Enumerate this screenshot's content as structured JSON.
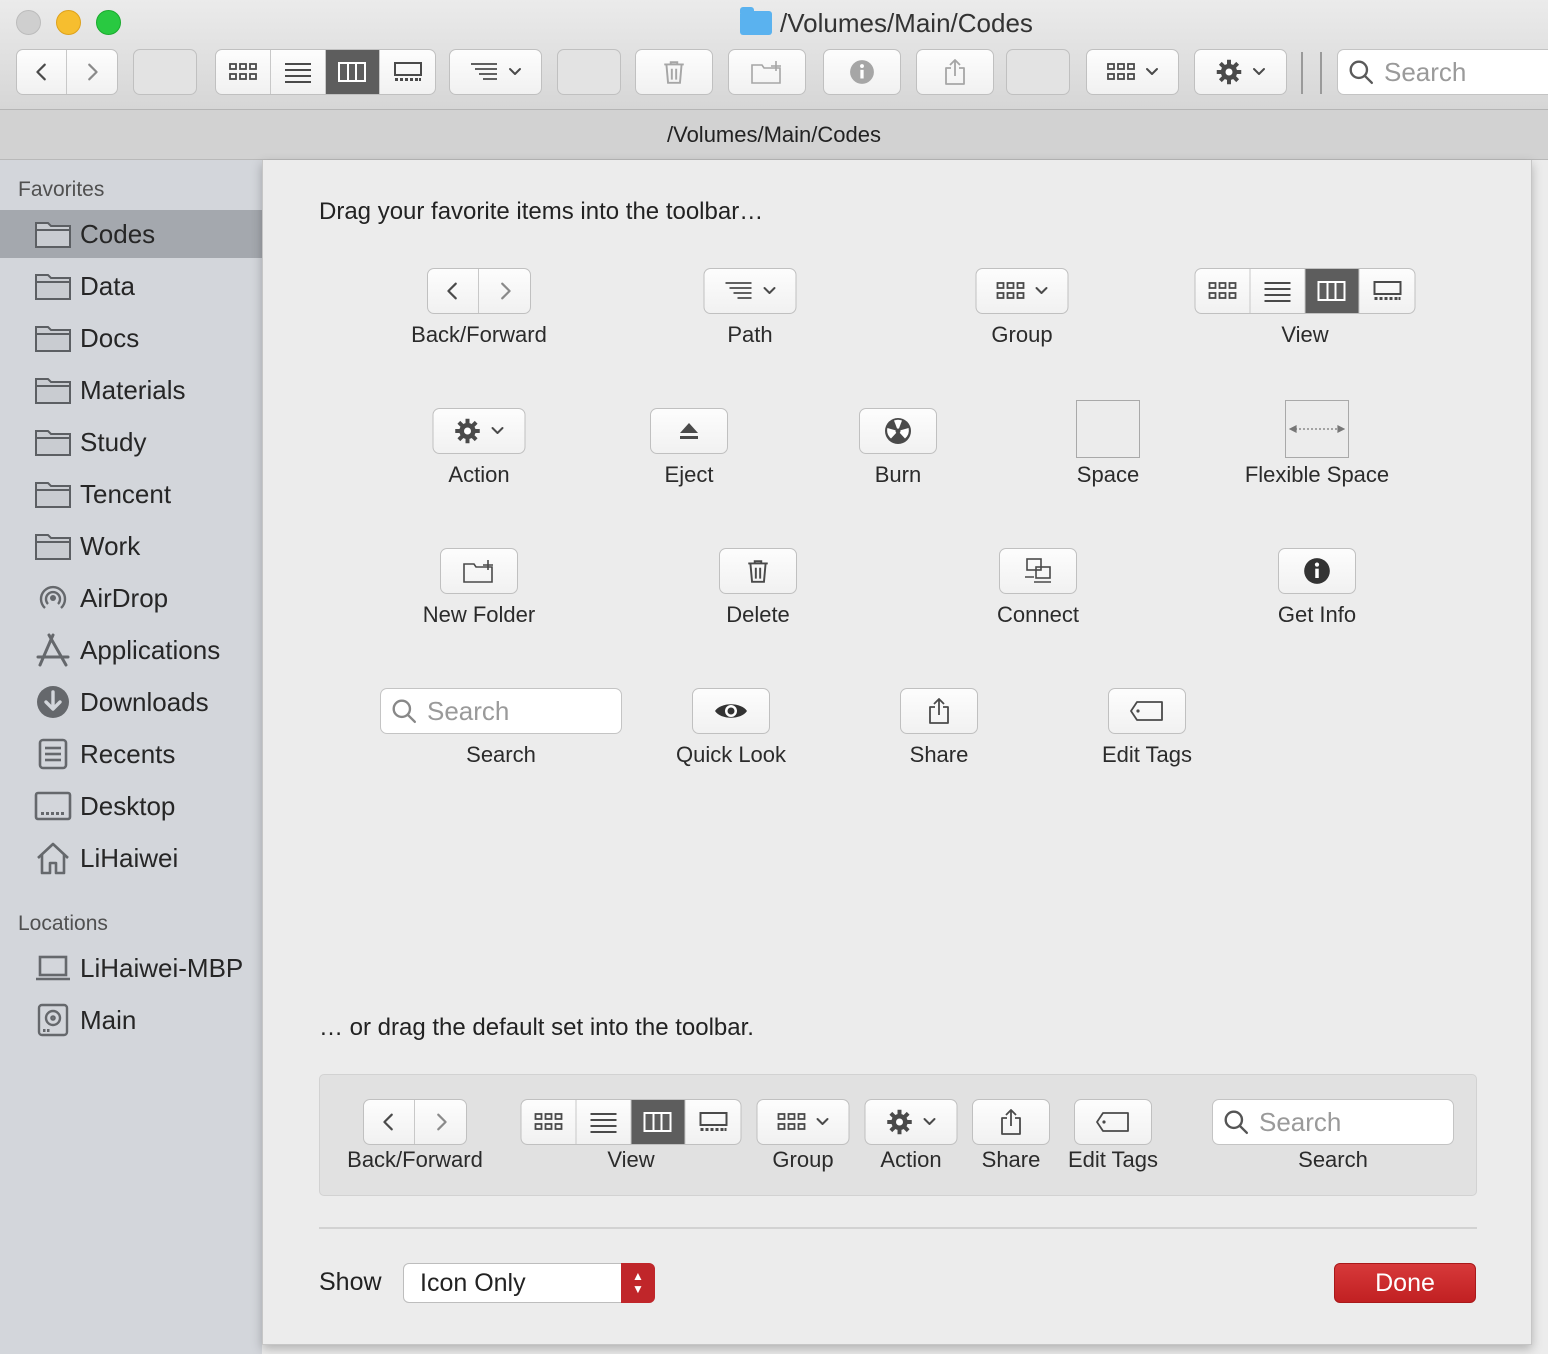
{
  "window": {
    "title": "/Volumes/Main/Codes",
    "path_bar": "/Volumes/Main/Codes"
  },
  "toolbar": {
    "search_placeholder": "Search"
  },
  "sidebar": {
    "favorites_header": "Favorites",
    "favorites": [
      {
        "label": "Codes",
        "icon": "folder-icon",
        "selected": true
      },
      {
        "label": "Data",
        "icon": "folder-icon"
      },
      {
        "label": "Docs",
        "icon": "folder-icon"
      },
      {
        "label": "Materials",
        "icon": "folder-icon"
      },
      {
        "label": "Study",
        "icon": "folder-icon"
      },
      {
        "label": "Tencent",
        "icon": "folder-icon"
      },
      {
        "label": "Work",
        "icon": "folder-icon"
      },
      {
        "label": "AirDrop",
        "icon": "airdrop-icon"
      },
      {
        "label": "Applications",
        "icon": "applications-icon"
      },
      {
        "label": "Downloads",
        "icon": "downloads-icon"
      },
      {
        "label": "Recents",
        "icon": "recents-icon"
      },
      {
        "label": "Desktop",
        "icon": "desktop-icon"
      },
      {
        "label": "LiHaiwei",
        "icon": "home-icon"
      }
    ],
    "locations_header": "Locations",
    "locations": [
      {
        "label": "LiHaiwei-MBP",
        "icon": "laptop-icon"
      },
      {
        "label": "Main",
        "icon": "disk-icon"
      }
    ]
  },
  "customize": {
    "heading": "Drag your favorite items into the toolbar…",
    "items": {
      "back_forward": "Back/Forward",
      "path": "Path",
      "group": "Group",
      "view": "View",
      "action": "Action",
      "eject": "Eject",
      "burn": "Burn",
      "space": "Space",
      "flexible_space": "Flexible Space",
      "new_folder": "New Folder",
      "delete": "Delete",
      "connect": "Connect",
      "get_info": "Get Info",
      "search": "Search",
      "search_placeholder": "Search",
      "quick_look": "Quick Look",
      "share": "Share",
      "edit_tags": "Edit Tags"
    },
    "default_heading": "… or drag the default set into the toolbar.",
    "default_set": {
      "back_forward": "Back/Forward",
      "view": "View",
      "group": "Group",
      "action": "Action",
      "share": "Share",
      "edit_tags": "Edit Tags",
      "search": "Search",
      "search_placeholder": "Search"
    },
    "show_label": "Show",
    "show_value": "Icon Only",
    "done_label": "Done"
  },
  "colors": {
    "done": "#c12022",
    "selection": "#a4a8ae",
    "folder": "#5ab2ef"
  }
}
